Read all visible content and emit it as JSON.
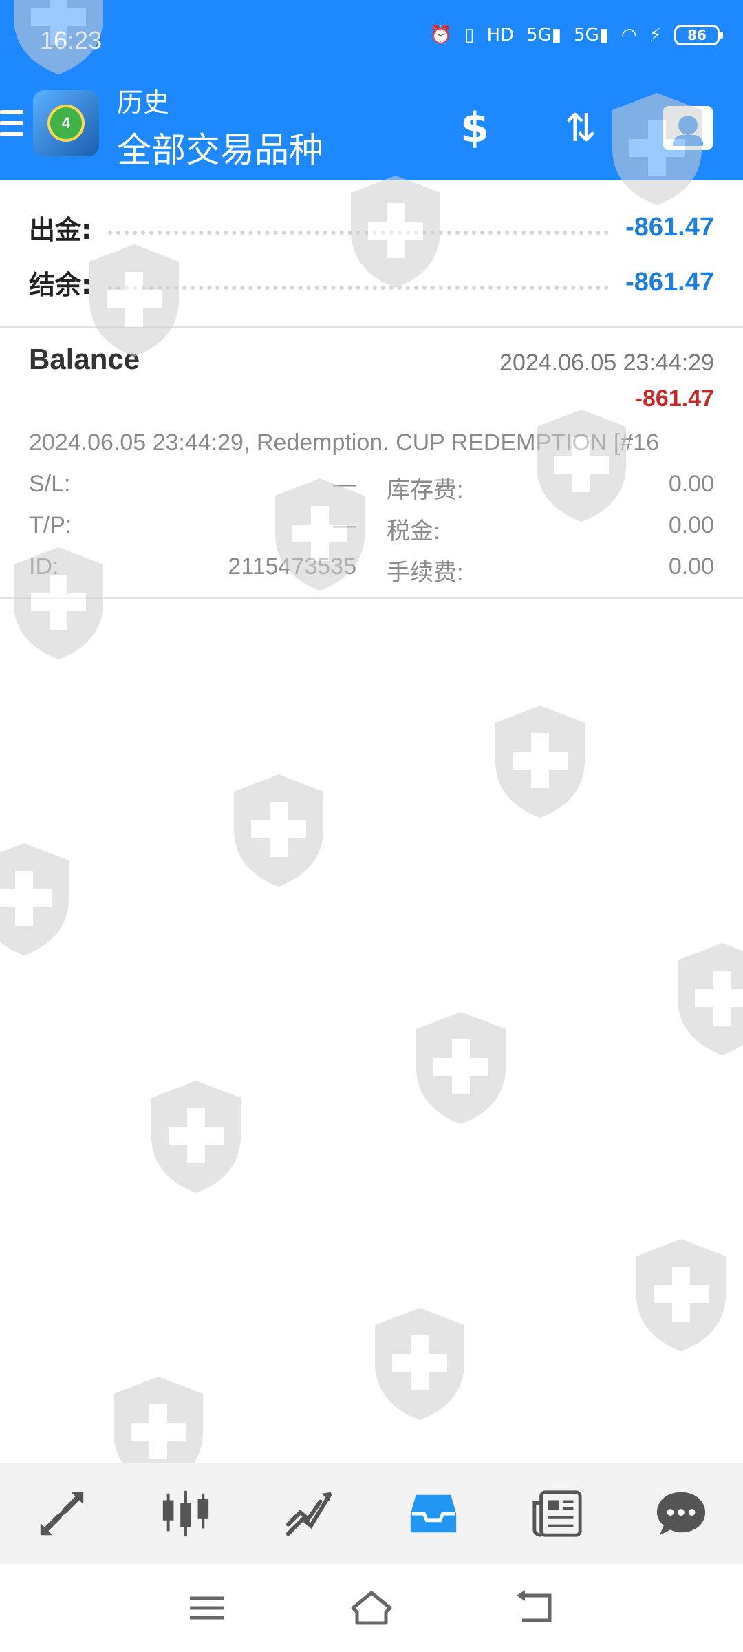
{
  "status_bar": {
    "time": "16:23",
    "battery": "86"
  },
  "header": {
    "title_small": "历史",
    "title_large": "全部交易品种",
    "accent_color": "#1E88FF"
  },
  "summary": {
    "withdrawal_label": "出金:",
    "withdrawal_value": "-861.47",
    "balance_label": "结余:",
    "balance_value": "-861.47"
  },
  "deal": {
    "type": "Balance",
    "time": "2024.06.05 23:44:29",
    "amount": "-861.47",
    "comment": "2024.06.05 23:44:29, Redemption. CUP REDEMPTION [#16",
    "fields": {
      "sl_label": "S/L:",
      "sl_value": "—",
      "tp_label": "T/P:",
      "tp_value": "—",
      "id_label": "ID:",
      "id_value": "2115473535",
      "swap_label": "库存费:",
      "swap_value": "0.00",
      "tax_label": "税金:",
      "tax_value": "0.00",
      "fee_label": "手续费:",
      "fee_value": "0.00"
    }
  },
  "bottom_nav": {
    "items": [
      {
        "icon": "trade-arrows-icon"
      },
      {
        "icon": "candlestick-chart-icon"
      },
      {
        "icon": "trend-chart-icon"
      },
      {
        "icon": "history-inbox-icon",
        "active": true
      },
      {
        "icon": "news-icon"
      },
      {
        "icon": "chat-icon"
      }
    ],
    "active_color": "#2196F3"
  },
  "system_nav": {
    "items": [
      "menu-icon",
      "home-icon",
      "back-icon"
    ]
  }
}
